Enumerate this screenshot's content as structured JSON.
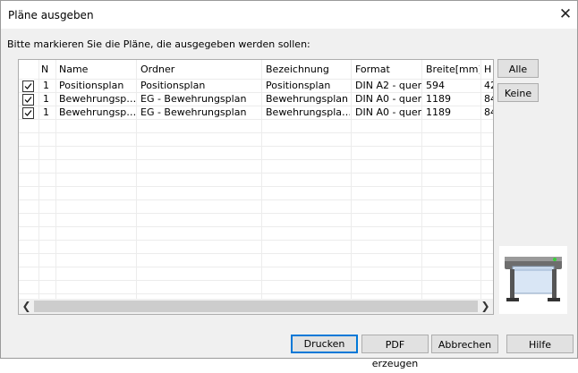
{
  "window": {
    "title": "Pläne ausgeben",
    "close_icon": "close-icon"
  },
  "instruction": "Bitte markieren Sie die Pläne, die ausgegeben werden sollen:",
  "table": {
    "columns": [
      "N",
      "Name",
      "Ordner",
      "Bezeichnung",
      "Format",
      "Breite[mm]",
      "H"
    ],
    "rows": [
      {
        "checked": true,
        "n": "1",
        "name": "Positionsplan",
        "ordner": "Positionsplan",
        "bezeichnung": "Positionsplan",
        "format": "DIN A2 - quer",
        "breite": "594",
        "h": "42"
      },
      {
        "checked": true,
        "n": "1",
        "name": "Bewehrungsp…",
        "ordner": "EG - Bewehrungsplan",
        "bezeichnung": "Bewehrungsplan",
        "format": "DIN A0 - quer",
        "breite": "1189",
        "h": "84"
      },
      {
        "checked": true,
        "n": "1",
        "name": "Bewehrungsp…",
        "ordner": "EG - Bewehrungsplan",
        "bezeichnung": "Bewehrungspla…",
        "format": "DIN A0 - quer",
        "breite": "1189",
        "h": "84"
      }
    ],
    "scroll_left_icon": "chevron-left-icon",
    "scroll_right_icon": "chevron-right-icon"
  },
  "side_buttons": {
    "all": "Alle",
    "none": "Keine"
  },
  "footer": {
    "print": "Drucken",
    "pdf": "PDF erzeugen",
    "cancel": "Abbrechen",
    "help": "Hilfe"
  },
  "plotter_icon": "plotter-icon",
  "colors": {
    "accent": "#0078d7",
    "button_face": "#e1e1e1",
    "window_bg": "#f0f0f0"
  }
}
